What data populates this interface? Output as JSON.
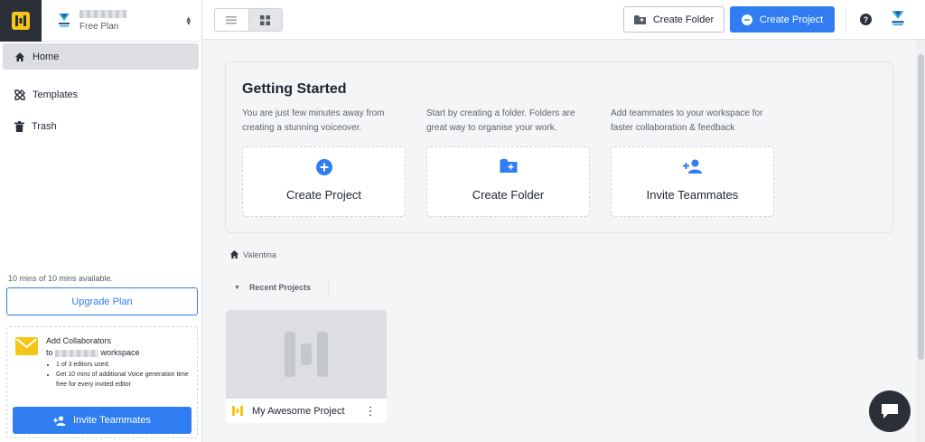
{
  "workspace": {
    "plan": "Free Plan"
  },
  "sidebar": {
    "items": [
      {
        "label": "Home",
        "icon": "home-icon",
        "active": true
      },
      {
        "label": "Templates",
        "icon": "templates-icon"
      },
      {
        "label": "Trash",
        "icon": "trash-icon"
      }
    ],
    "minutes_text": "10 mins of 10 mins available.",
    "upgrade_label": "Upgrade Plan",
    "collab": {
      "title_line1": "Add Collaborators",
      "title_to": "to",
      "title_suffix": "workspace",
      "bullets": [
        "1 of 3 editors used.",
        "Get 10 mins of additional Voice generation time free for every invited editor"
      ],
      "invite_label": "Invite Teammates"
    }
  },
  "topbar": {
    "create_folder_label": "Create Folder",
    "create_project_label": "Create Project"
  },
  "getting_started": {
    "title": "Getting Started",
    "columns": [
      {
        "desc": "You are just few minutes away from creating a stunning voiceover.",
        "card_label": "Create Project"
      },
      {
        "desc": "Start by creating a folder. Folders are great way to organise your work.",
        "card_label": "Create Folder"
      },
      {
        "desc": "Add teammates to your workspace for faster collaboration & feedback",
        "card_label": "Invite Teammates"
      }
    ]
  },
  "breadcrumb": {
    "label": "Valentina"
  },
  "recent": {
    "label": "Recent Projects"
  },
  "projects": [
    {
      "name": "My Awesome Project"
    }
  ],
  "colors": {
    "accent": "#2f7df0",
    "brand_yellow": "#f5c518",
    "dark": "#2b3038"
  }
}
